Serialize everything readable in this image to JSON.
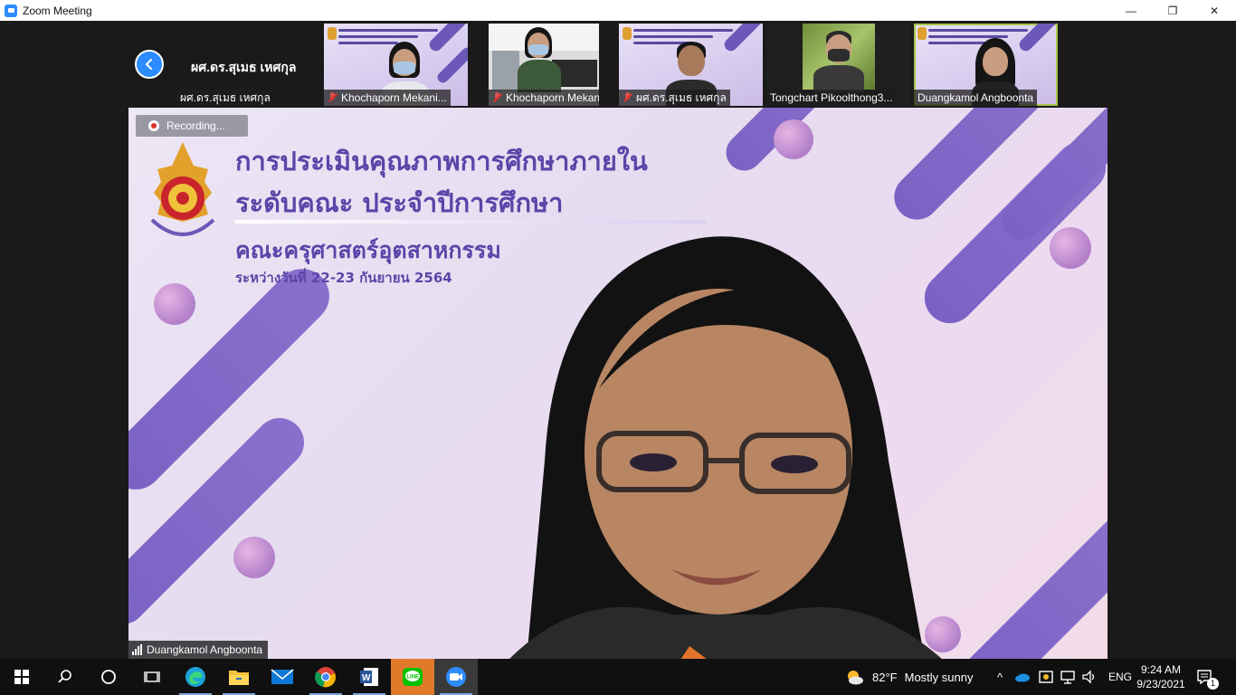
{
  "window": {
    "title": "Zoom Meeting",
    "minimize_glyph": "—",
    "restore_glyph": "❐",
    "close_glyph": "✕"
  },
  "gallery": {
    "prev_icon": "chevron-left-icon",
    "first_tile": {
      "display_name": "ผศ.ดร.สุเมธ เหศกุล",
      "name_tag": "ผศ.ดร.สุเมธ เหศกุล"
    },
    "participants": [
      {
        "name": "Khochaporn Mekani...",
        "muted": true
      },
      {
        "name": "Khochaporn Mekani...",
        "muted": true
      },
      {
        "name": "ผศ.ดร.สุเมธ เหศกุล",
        "muted": true
      },
      {
        "name": "Tongchart Pikoolthong3...",
        "muted": false
      },
      {
        "name": "Duangkamol Angboonta",
        "muted": false,
        "active_speaker": true
      }
    ]
  },
  "main_video": {
    "recording_label": "Recording...",
    "slide": {
      "line1": "การประเมินคุณภาพการศึกษาภายใน",
      "line2": "ระดับคณะ ประจำปีการศึกษา",
      "line3": "คณะครุศาสตร์อุตสาหกรรม",
      "line4": "ระหว่างวันที่ 22-23 กันยายน 2564"
    },
    "speaker_name": "Duangkamol Angboonta",
    "accent_color": "#6b58b8"
  },
  "taskbar": {
    "apps": [
      "start-icon",
      "search-icon",
      "cortana-icon",
      "task-view-icon",
      "edge-icon",
      "file-explorer-icon",
      "mail-icon",
      "chrome-icon",
      "word-icon",
      "line-icon",
      "zoom-icon"
    ],
    "weather": {
      "temp": "82°F",
      "condition": "Mostly sunny"
    },
    "language": "ENG",
    "time": "9:24 AM",
    "date": "9/23/2021",
    "notification_count": "1"
  }
}
